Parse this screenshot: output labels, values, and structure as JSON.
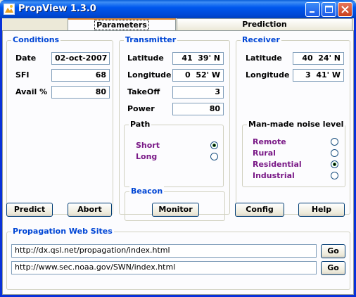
{
  "window": {
    "title": "PropView 1.3.0"
  },
  "tabs": [
    {
      "label": "Parameters"
    },
    {
      "label": "Prediction"
    }
  ],
  "conditions": {
    "title": "Conditions",
    "date_label": "Date",
    "date_value": "02-oct-2007",
    "sfi_label": "SFI",
    "sfi_value": "68",
    "avail_label": "Avail %",
    "avail_value": "80"
  },
  "transmitter": {
    "title": "Transmitter",
    "lat_label": "Latitude",
    "lat_value": "41  39' N",
    "lon_label": "Longitude",
    "lon_value": "0  52' W",
    "takeoff_label": "TakeOff",
    "takeoff_value": "3",
    "power_label": "Power",
    "power_value": "80",
    "path": {
      "title": "Path",
      "short_label": "Short",
      "long_label": "Long",
      "selected": "Short"
    }
  },
  "receiver": {
    "title": "Receiver",
    "lat_label": "Latitude",
    "lat_value": "40  24' N",
    "lon_label": "Longitude",
    "lon_value": "3  41' W",
    "noise": {
      "title": "Man-made noise level",
      "options": [
        "Remote",
        "Rural",
        "Residential",
        "Industrial"
      ],
      "selected": "Residential"
    }
  },
  "beacon": {
    "title": "Beacon",
    "monitor_label": "Monitor"
  },
  "buttons": {
    "predict": "Predict",
    "abort": "Abort",
    "config": "Config",
    "help": "Help"
  },
  "websites": {
    "title": "Propagation Web Sites",
    "url1": "http://dx.qsl.net/propagation/index.html",
    "url2": "http://www.sec.noaa.gov/SWN/index.html",
    "go_label": "Go"
  }
}
